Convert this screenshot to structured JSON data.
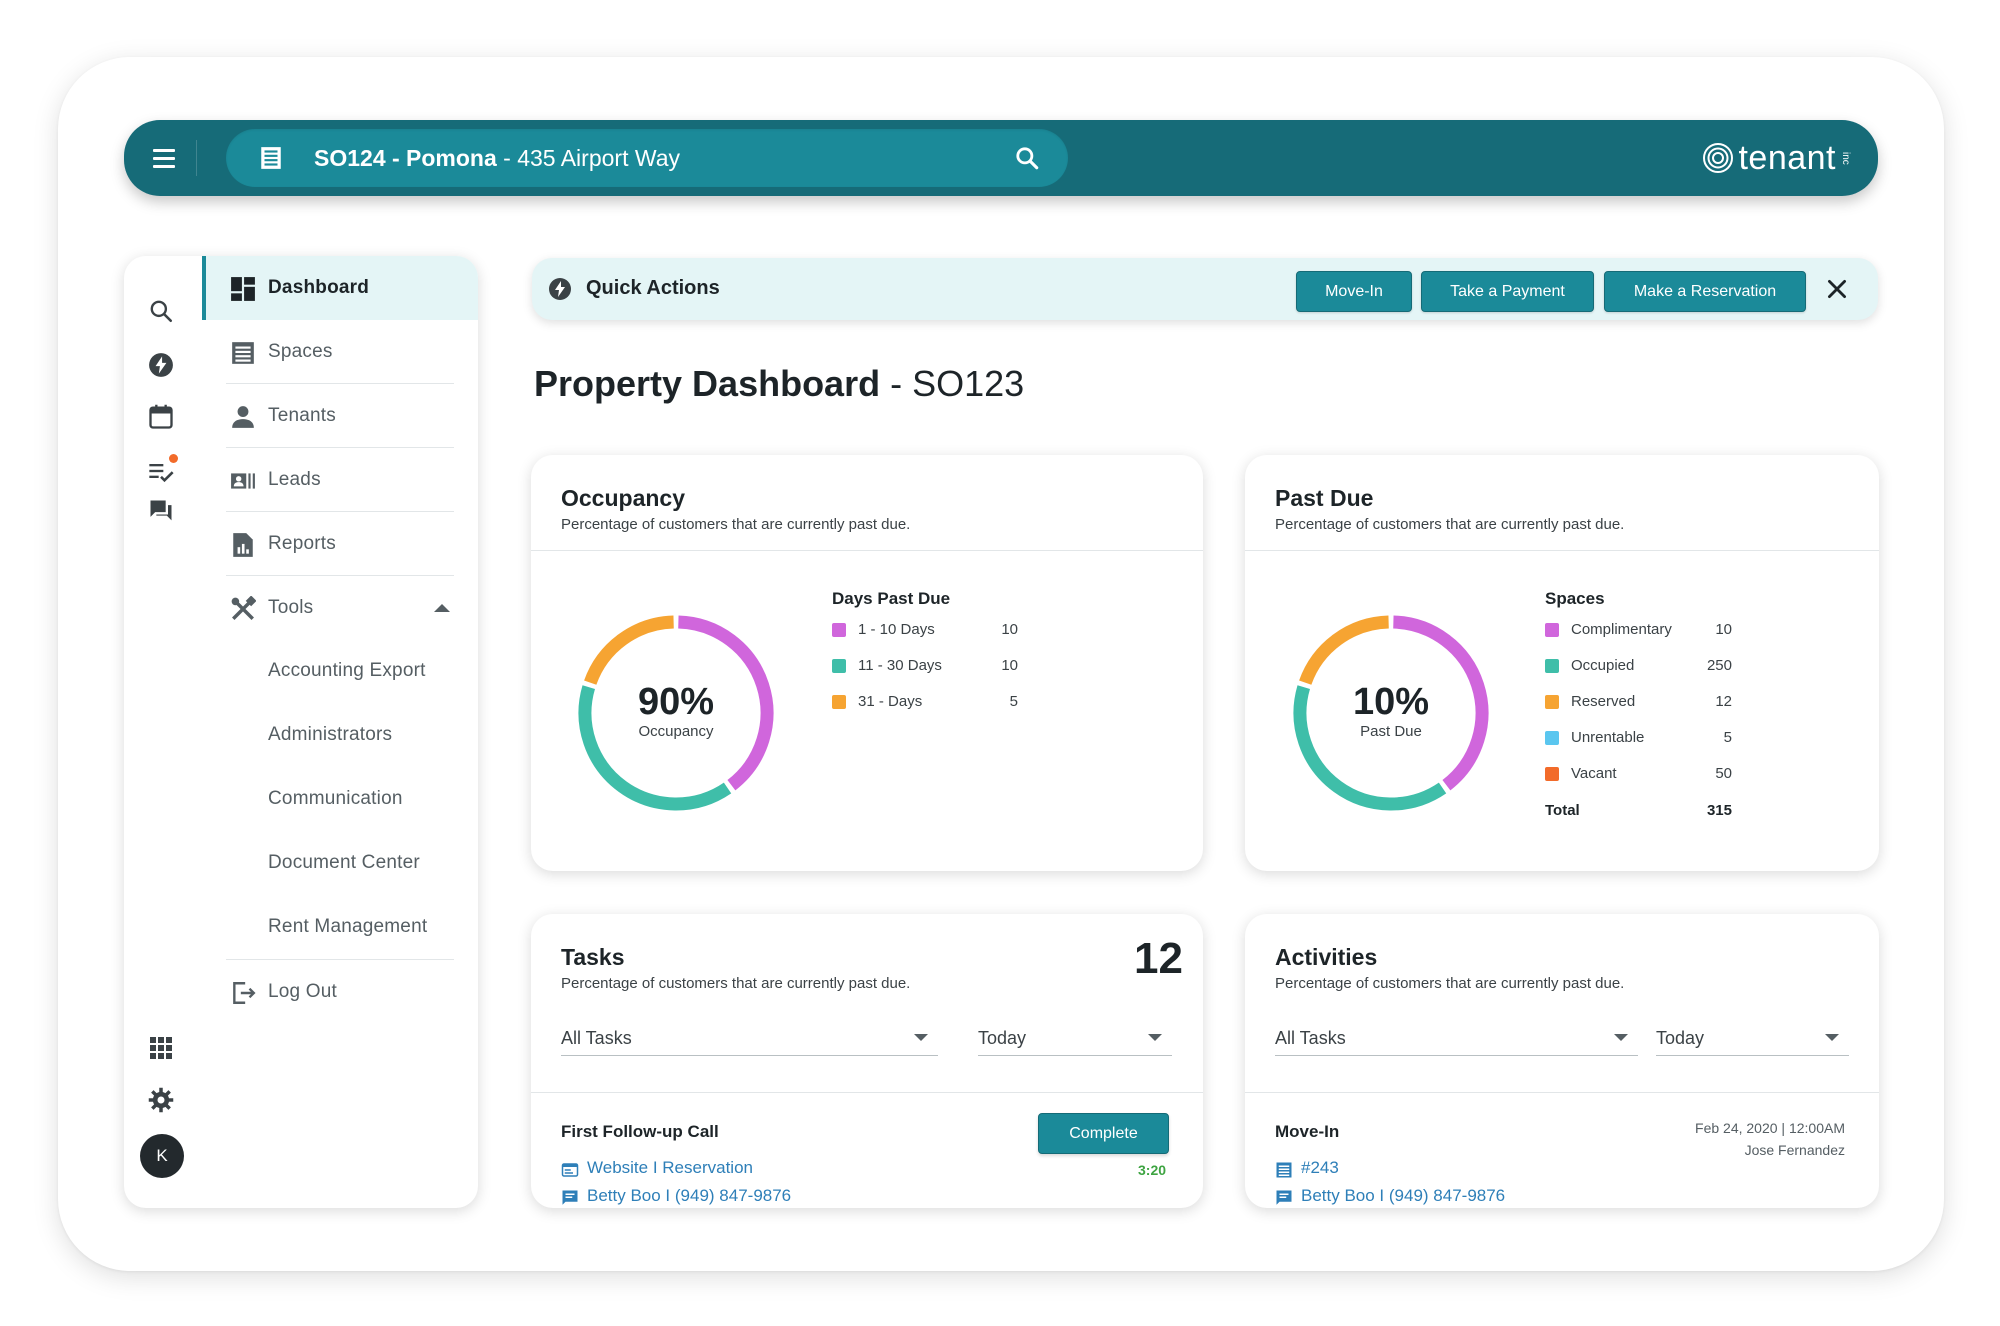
{
  "topbar": {
    "location_code": "SO124 - Pomona",
    "location_address": " - 435 Airport Way",
    "logo_text": "tenant",
    "logo_suffix": "inc"
  },
  "sidebar": {
    "avatar_initial": "K",
    "items": [
      {
        "label": "Dashboard",
        "icon": "dashboard-icon"
      },
      {
        "label": "Spaces",
        "icon": "storage-unit-icon"
      },
      {
        "label": "Tenants",
        "icon": "person-icon"
      },
      {
        "label": "Leads",
        "icon": "contact-card-icon"
      },
      {
        "label": "Reports",
        "icon": "report-icon"
      },
      {
        "label": "Tools",
        "icon": "tools-icon"
      }
    ],
    "tools_subitems": [
      {
        "label": "Accounting Export"
      },
      {
        "label": "Administrators"
      },
      {
        "label": "Communication"
      },
      {
        "label": "Document Center"
      },
      {
        "label": "Rent Management"
      }
    ],
    "logout_label": "Log Out"
  },
  "quick_actions": {
    "title": "Quick Actions",
    "buttons": [
      {
        "label": "Move-In"
      },
      {
        "label": "Take a Payment"
      },
      {
        "label": "Make a Reservation"
      }
    ]
  },
  "page": {
    "title_main": "Property Dashboard",
    "title_suffix": " - SO123"
  },
  "occupancy": {
    "title": "Occupancy",
    "subtitle": "Percentage of customers that are currently past due.",
    "center_value": "90%",
    "center_label": "Occupancy",
    "legend_title": "Days Past Due",
    "legend": [
      {
        "label": "1 - 10 Days",
        "value": "10",
        "color": "#d066dc"
      },
      {
        "label": "11 - 30 Days",
        "value": "10",
        "color": "#3fbea9"
      },
      {
        "label": "31 - Days",
        "value": "5",
        "color": "#f6a432"
      }
    ]
  },
  "past_due": {
    "title": "Past Due",
    "subtitle": "Percentage of customers that are currently past due.",
    "center_value": "10%",
    "center_label": "Past Due",
    "legend_title": "Spaces",
    "legend": [
      {
        "label": "Complimentary",
        "value": "10",
        "color": "#d066dc"
      },
      {
        "label": "Occupied",
        "value": "250",
        "color": "#3fbea9"
      },
      {
        "label": "Reserved",
        "value": "12",
        "color": "#f6a432"
      },
      {
        "label": "Unrentable",
        "value": "5",
        "color": "#5ac6ef"
      },
      {
        "label": "Vacant",
        "value": "50",
        "color": "#f26b2a"
      }
    ],
    "total_label": "Total",
    "total_value": "315"
  },
  "tasks": {
    "title": "Tasks",
    "subtitle": "Percentage of customers that are currently past due.",
    "count": "12",
    "filter": "All Tasks",
    "period": "Today",
    "item": {
      "title": "First Follow-up Call",
      "button": "Complete",
      "timer": "3:20",
      "link1": "Website I Reservation",
      "link2": "Betty Boo I (949) 847-9876"
    }
  },
  "activities": {
    "title": "Activities",
    "subtitle": "Percentage of customers that are currently past due.",
    "filter": "All Tasks",
    "period": "Today",
    "item": {
      "title": "Move-In",
      "datetime": "Feb 24, 2020 | 12:00AM",
      "user": "Jose Fernandez",
      "link1": "#243",
      "link2": "Betty Boo I (949) 847-9876"
    }
  },
  "colors": {
    "topbar": "#166b78",
    "accent": "#1b8a99",
    "active_bg": "#e4f5f6",
    "link": "#2e7fb8",
    "timer": "#3ea442"
  },
  "chart_data": [
    {
      "type": "pie",
      "title": "Occupancy",
      "categories": [
        "1 - 10 Days",
        "11 - 30 Days",
        "31 - Days"
      ],
      "values": [
        10,
        10,
        5
      ]
    },
    {
      "type": "pie",
      "title": "Past Due",
      "categories": [
        "Complimentary",
        "Occupied",
        "Reserved",
        "Unrentable",
        "Vacant"
      ],
      "values": [
        10,
        250,
        12,
        5,
        50
      ],
      "note_visible_segments": [
        "Complimentary",
        "Occupied",
        "Reserved"
      ]
    }
  ]
}
